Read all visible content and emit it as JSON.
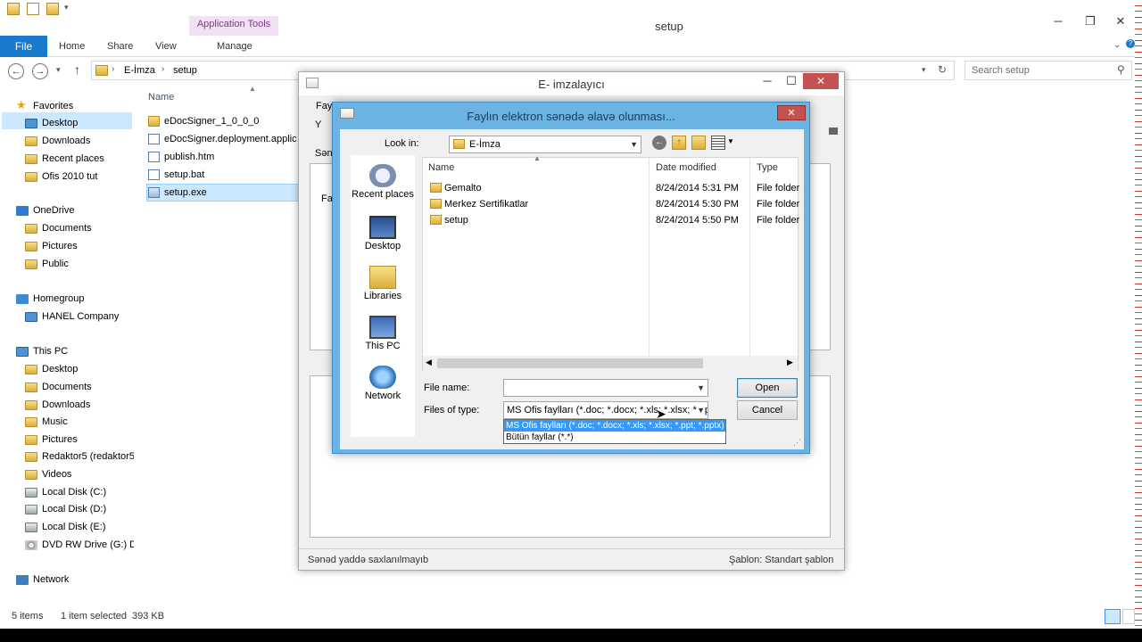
{
  "explorer": {
    "title": "setup",
    "context_tab": "Application Tools",
    "ribbon_tabs": {
      "file": "File",
      "home": "Home",
      "share": "Share",
      "view": "View",
      "manage": "Manage"
    },
    "caption": {
      "minimize": "─",
      "maximize": "❐",
      "close": "✕"
    },
    "breadcrumb": [
      "E-İmza",
      "setup"
    ],
    "search_placeholder": "Search setup",
    "nav": [
      {
        "label": "Favorites",
        "icon": "star-icon"
      },
      {
        "label": "Desktop",
        "icon": "desktop-icon"
      },
      {
        "label": "Downloads",
        "icon": "folder-icon"
      },
      {
        "label": "Recent places",
        "icon": "folder-icon"
      },
      {
        "label": "Ofis 2010 tut",
        "icon": "folder-icon"
      },
      {
        "label": "OneDrive",
        "icon": "cloud-icon"
      },
      {
        "label": "Documents",
        "icon": "folder-icon"
      },
      {
        "label": "Pictures",
        "icon": "folder-icon"
      },
      {
        "label": "Public",
        "icon": "folder-icon"
      },
      {
        "label": "Homegroup",
        "icon": "homegroup-icon"
      },
      {
        "label": "HANEL Company",
        "icon": "user-icon"
      },
      {
        "label": "This PC",
        "icon": "computer-icon"
      },
      {
        "label": "Desktop",
        "icon": "folder-icon"
      },
      {
        "label": "Documents",
        "icon": "folder-icon"
      },
      {
        "label": "Downloads",
        "icon": "folder-icon"
      },
      {
        "label": "Music",
        "icon": "folder-icon"
      },
      {
        "label": "Pictures",
        "icon": "folder-icon"
      },
      {
        "label": "Redaktor5 (redaktor5",
        "icon": "folder-icon"
      },
      {
        "label": "Videos",
        "icon": "folder-icon"
      },
      {
        "label": "Local Disk (C:)",
        "icon": "drive-icon"
      },
      {
        "label": "Local Disk (D:)",
        "icon": "drive-icon"
      },
      {
        "label": "Local Disk (E:)",
        "icon": "drive-icon"
      },
      {
        "label": "DVD RW Drive (G:) D",
        "icon": "dvd-icon"
      },
      {
        "label": "Network",
        "icon": "network-icon"
      }
    ],
    "column_name": "Name",
    "files": [
      {
        "name": "eDocSigner_1_0_0_0",
        "icon": "folder-icon"
      },
      {
        "name": "eDocSigner.deployment.applic",
        "icon": "file-icon"
      },
      {
        "name": "publish.htm",
        "icon": "file-icon"
      },
      {
        "name": "setup.bat",
        "icon": "file-icon"
      },
      {
        "name": "setup.exe",
        "icon": "exe-icon"
      }
    ],
    "status": {
      "items": "5 items",
      "selected": "1 item selected",
      "size": "393 KB"
    }
  },
  "eimza": {
    "title": "E- imzalayıcı",
    "frag1": "Fay",
    "frag2": "Y",
    "frag3": "Sən",
    "frag4": "Fa",
    "status_left": "Sənəd yaddə saxlanılmayıb",
    "status_right": "Şablon: Standart şablon"
  },
  "dialog": {
    "title": "Faylın elektron sənədə əlavə olunması...",
    "look_in_label": "Look in:",
    "look_in_value": "E-İmza",
    "places": [
      "Recent places",
      "Desktop",
      "Libraries",
      "This PC",
      "Network"
    ],
    "columns": {
      "name": "Name",
      "date": "Date modified",
      "type": "Type"
    },
    "rows": [
      {
        "name": "Gemalto",
        "date": "8/24/2014 5:31 PM",
        "type": "File folder"
      },
      {
        "name": "Merkez Sertifikatlar",
        "date": "8/24/2014 5:30 PM",
        "type": "File folder"
      },
      {
        "name": "setup",
        "date": "8/24/2014 5:50 PM",
        "type": "File folder"
      }
    ],
    "file_name_label": "File name:",
    "file_name_value": "",
    "files_of_type_label": "Files of type:",
    "files_of_type_value": "MS Ofis faylları (*.doc; *.docx; *.xls; *.xlsx; *.ppt;",
    "type_options": [
      "MS Ofis faylları (*.doc; *.docx; *.xls; *.xlsx; *.ppt; *.pptx)",
      "Bütün fayllar (*.*)"
    ],
    "open_label": "Open",
    "cancel_label": "Cancel"
  },
  "colors": {
    "accent": "#1979ca",
    "dialog_frame": "#6bb3e3",
    "selection": "#cce8ff",
    "close_red": "#c75050"
  }
}
